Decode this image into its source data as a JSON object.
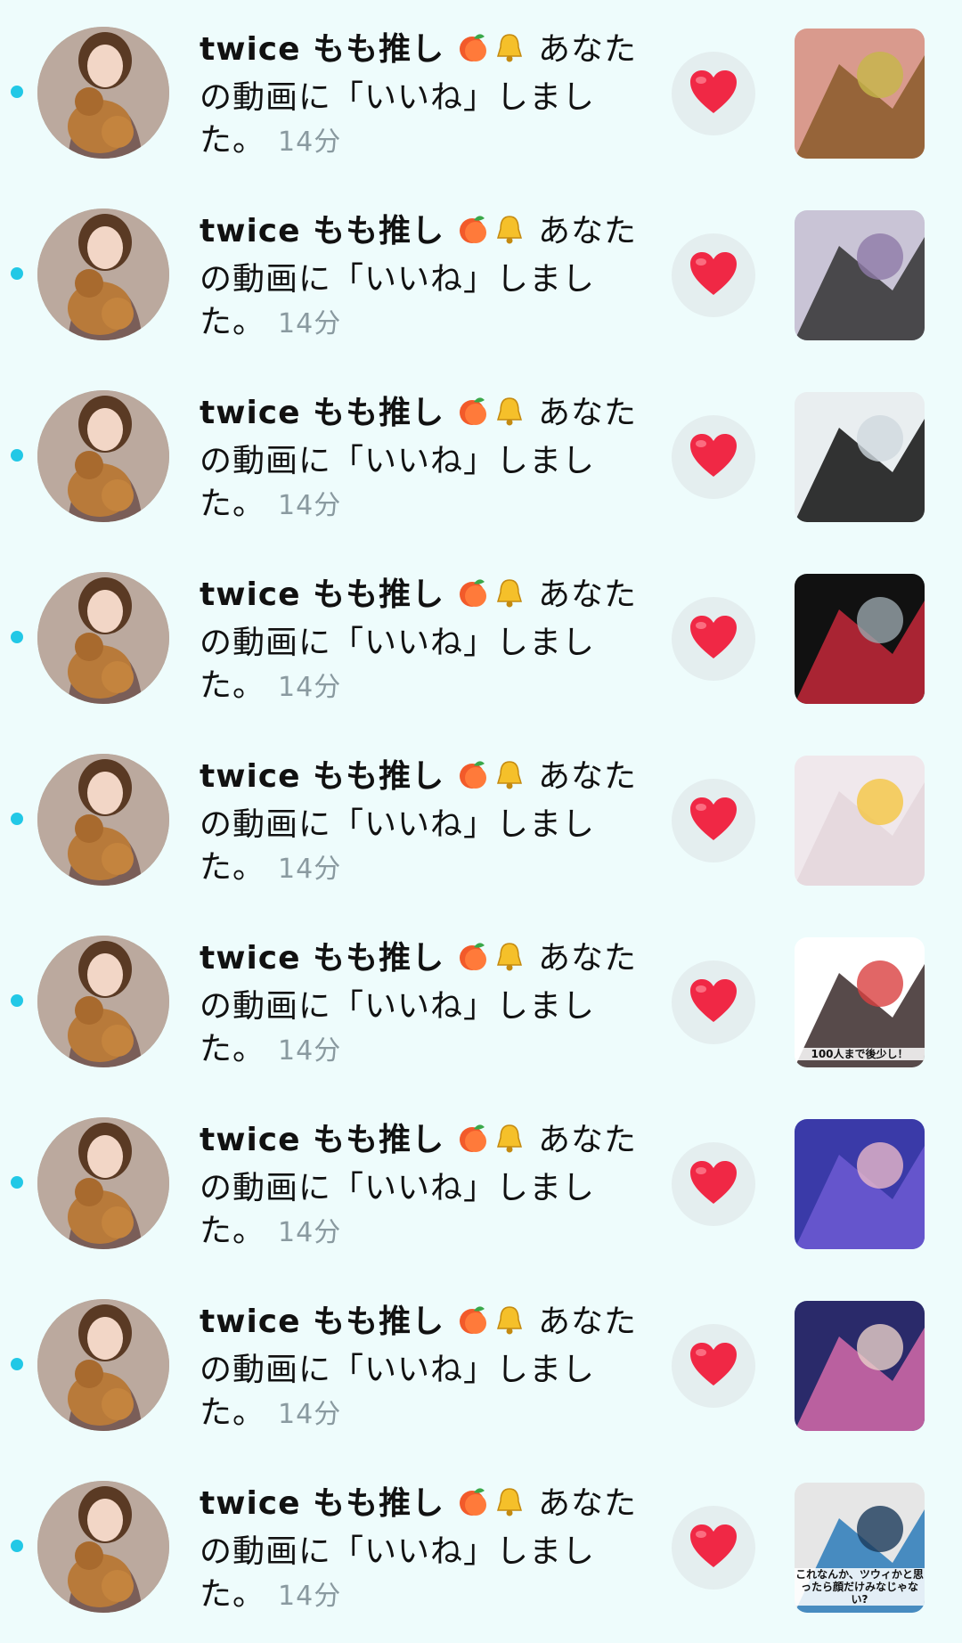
{
  "notifications": [
    {
      "username": "twice もも推し",
      "message_head": "あなた",
      "message_rest": "の動画に「いいね」しまし た。",
      "time": "14分",
      "thumb_colors": [
        "#d99a8d",
        "#8a5a2a",
        "#c6b64a"
      ]
    },
    {
      "username": "twice もも推し",
      "message_head": "あなた",
      "message_rest": "の動画に「いいね」しまし た。",
      "time": "14分",
      "thumb_colors": [
        "#c9c4d6",
        "#333333",
        "#8e7aa8"
      ]
    },
    {
      "username": "twice もも推し",
      "message_head": "あなた",
      "message_rest": "の動画に「いいね」しまし た。",
      "time": "14分",
      "thumb_colors": [
        "#e9eef0",
        "#111111",
        "#cfd8de"
      ]
    },
    {
      "username": "twice もも推し",
      "message_head": "あなた",
      "message_rest": "の動画に「いいね」しまし た。",
      "time": "14分",
      "thumb_colors": [
        "#111111",
        "#c4283a",
        "#9aa6ad"
      ]
    },
    {
      "username": "twice もも推し",
      "message_head": "あなた",
      "message_rest": "の動画に「いいね」しまし た。",
      "time": "14分",
      "thumb_colors": [
        "#f0e8ec",
        "#e4d6dc",
        "#f5c542"
      ]
    },
    {
      "username": "twice もも推し",
      "message_head": "あなた",
      "message_rest": "の動画に「いいね」しまし た。",
      "time": "14分",
      "thumb_colors": [
        "#ffffff",
        "#3a2a2a",
        "#d94040"
      ],
      "thumb_caption": "100人まで後少し！"
    },
    {
      "username": "twice もも推し",
      "message_head": "あなた",
      "message_rest": "の動画に「いいね」しまし た。",
      "time": "14分",
      "thumb_colors": [
        "#3a3aa8",
        "#6d5ad2",
        "#e8b8c8"
      ]
    },
    {
      "username": "twice もも推し",
      "message_head": "あなた",
      "message_rest": "の動画に「いいね」しまし た。",
      "time": "14分",
      "thumb_colors": [
        "#2a2a6a",
        "#d46aa8",
        "#e8d0c8"
      ]
    },
    {
      "username": "twice もも推し",
      "message_head": "あなた",
      "message_rest": "の動画に「いいね」しまし た。",
      "time": "14分",
      "thumb_colors": [
        "#e6e6e6",
        "#2a7ab8",
        "#1a3a5a"
      ],
      "thumb_caption": "これなんか、ツウィかと思ったら顔だけみなじゃない?"
    }
  ]
}
